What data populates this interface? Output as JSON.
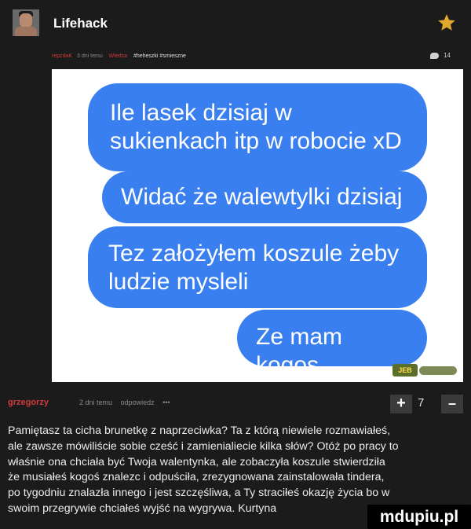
{
  "header": {
    "title": "Lifehack",
    "star_icon": "star-icon",
    "star_color": "#e0a82e"
  },
  "post_meta": {
    "author": "repzdaK",
    "time": "3 dni temu",
    "category": "Wiedza",
    "tags": "#heheszki #smieszne",
    "comment_count": "14"
  },
  "image": {
    "messages": [
      "Ile lasek dzisiaj w sukienkach itp w robocie xD",
      "Widać że walewtylki dzisiaj",
      "Tez założyłem koszule żeby ludzie mysleli",
      "Ze mam kogos"
    ],
    "bubble_color": "#3a7ff0",
    "watermark": "JEB"
  },
  "comment": {
    "author": "grzegorzy",
    "time": "2 dni temu",
    "reply": "odpowiedz",
    "more": "•••",
    "upvote_label": "+",
    "score": "7",
    "downvote_label": "–",
    "lines": [
      "Pamiętasz ta cicha brunetkę z naprzeciwka? Ta z którą niewiele rozmawiałeś,",
      "ale zawsze mówiliście sobie cześć i zamienialiecie kilka słów? Otóż po pracy to",
      "właśnie ona chciała być Twoja walentynka, ale zobaczyła koszule stwierdziła",
      "że musiałeś kogoś znalezc i odpuściła, zrezygnowana zainstalowała tindera,",
      "po tygodniu znalazła innego i jest szczęśliwa, a Ty straciłeś okazję życia bo w",
      "swoim przegrywie chciałeś wyjść na wygrywa. Kurtyna"
    ]
  },
  "site_mark": "mdupiu.pl"
}
